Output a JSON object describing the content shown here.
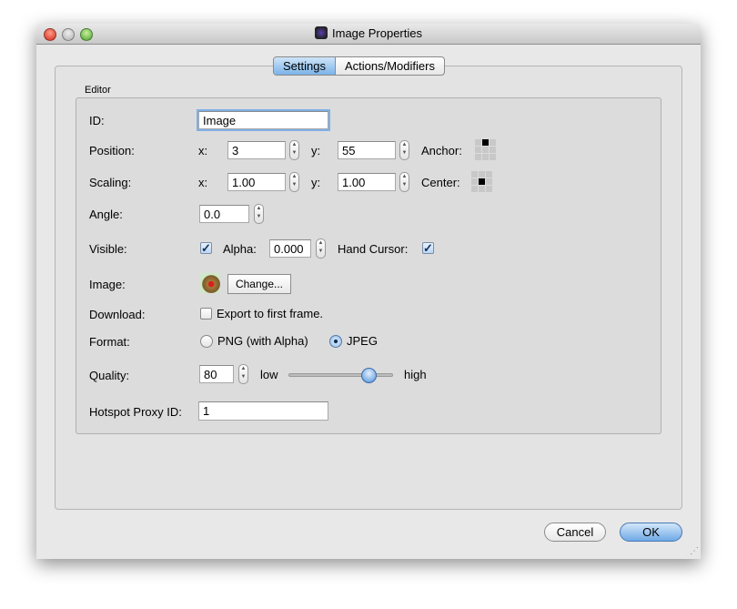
{
  "window": {
    "title": "Image Properties",
    "title_icon": "app-icon"
  },
  "tabs": [
    {
      "label": "Settings",
      "selected": true
    },
    {
      "label": "Actions/Modifiers",
      "selected": false
    }
  ],
  "group_label": "Editor",
  "fields": {
    "id": {
      "label": "ID:",
      "value": "Image"
    },
    "position": {
      "label": "Position:",
      "x_label": "x:",
      "x": "3",
      "y_label": "y:",
      "y": "55",
      "anchor_label": "Anchor:"
    },
    "scaling": {
      "label": "Scaling:",
      "x_label": "x:",
      "x": "1.00",
      "y_label": "y:",
      "y": "1.00",
      "center_label": "Center:"
    },
    "angle": {
      "label": "Angle:",
      "value": "0.0"
    },
    "visible": {
      "label": "Visible:",
      "checked": true,
      "alpha_label": "Alpha:",
      "alpha": "0.000",
      "hand_cursor_label": "Hand Cursor:",
      "hand_cursor": true
    },
    "image": {
      "label": "Image:",
      "change_label": "Change..."
    },
    "download": {
      "label": "Download:",
      "checkbox_label": "Export to first frame.",
      "checked": false
    },
    "format": {
      "label": "Format:",
      "options": [
        "PNG (with Alpha)",
        "JPEG"
      ],
      "selected": "JPEG"
    },
    "quality": {
      "label": "Quality:",
      "value": "80",
      "low_label": "low",
      "high_label": "high",
      "slider_percent": 80
    },
    "hotspot": {
      "label": "Hotspot Proxy ID:",
      "value": "1"
    }
  },
  "buttons": {
    "cancel": "Cancel",
    "ok": "OK"
  },
  "check_glyph": "✓"
}
